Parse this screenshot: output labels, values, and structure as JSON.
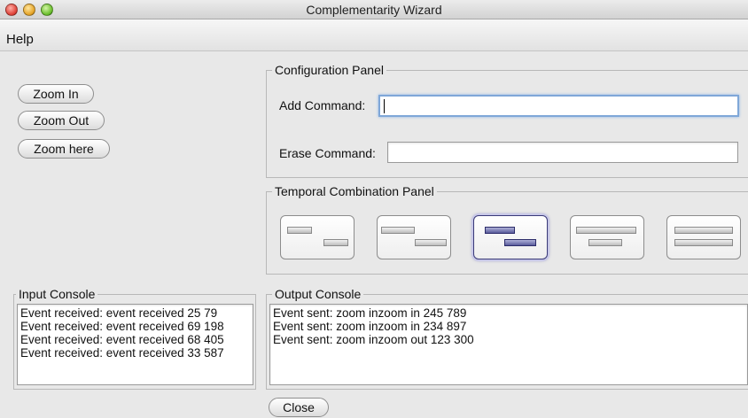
{
  "window": {
    "title": "Complementarity Wizard"
  },
  "menubar": {
    "help_label": "Help"
  },
  "zoom_buttons": {
    "zoom_in": "Zoom In",
    "zoom_out": "Zoom Out",
    "zoom_here": "Zoom here"
  },
  "config_panel": {
    "title": "Configuration Panel",
    "add_command_label": "Add Command:",
    "add_command_value": "",
    "erase_command_label": "Erase Command:",
    "erase_command_value": ""
  },
  "temporal_panel": {
    "title": "Temporal Combination Panel",
    "options": [
      "sequential",
      "sequential-gap",
      "overlap",
      "during",
      "equal"
    ],
    "selected": "overlap"
  },
  "input_console": {
    "title": "Input Console",
    "lines": [
      "Event received: event received 25 79",
      "Event received: event received 69 198",
      "Event received: event received 68 405",
      "Event received: event received 33 587"
    ]
  },
  "output_console": {
    "title": "Output Console",
    "lines": [
      "Event sent: zoom inzoom in 245 789",
      "Event sent: zoom inzoom in 234 897",
      "Event sent: zoom inzoom out 123 300"
    ]
  },
  "footer": {
    "close_label": "Close"
  },
  "colors": {
    "selection_accent": "#5a5c9c",
    "focus_ring": "#7fa7d8"
  }
}
